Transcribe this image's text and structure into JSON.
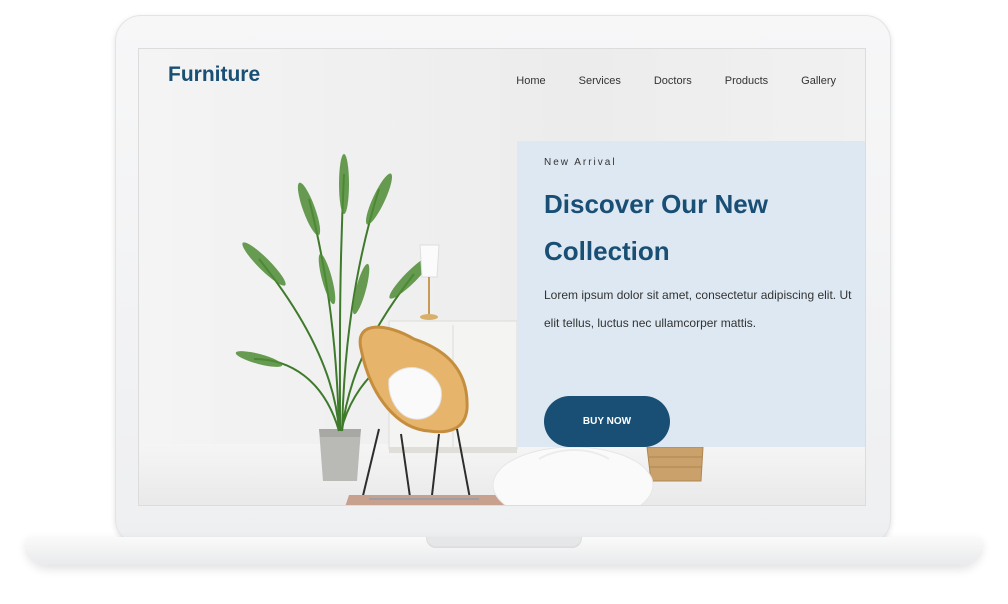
{
  "header": {
    "brand": "Furniture",
    "nav": [
      "Home",
      "Services",
      "Doctors",
      "Products",
      "Gallery"
    ]
  },
  "hero": {
    "eyebrow": "New Arrival",
    "headline": "Discover Our New Collection",
    "body": "Lorem ipsum dolor sit amet, consectetur adipiscing elit. Ut elit tellus, luctus nec ullamcorper mattis.",
    "cta": "BUY NOW"
  },
  "colors": {
    "brand_navy": "#194f74",
    "card_bg": "#dde8f2"
  }
}
